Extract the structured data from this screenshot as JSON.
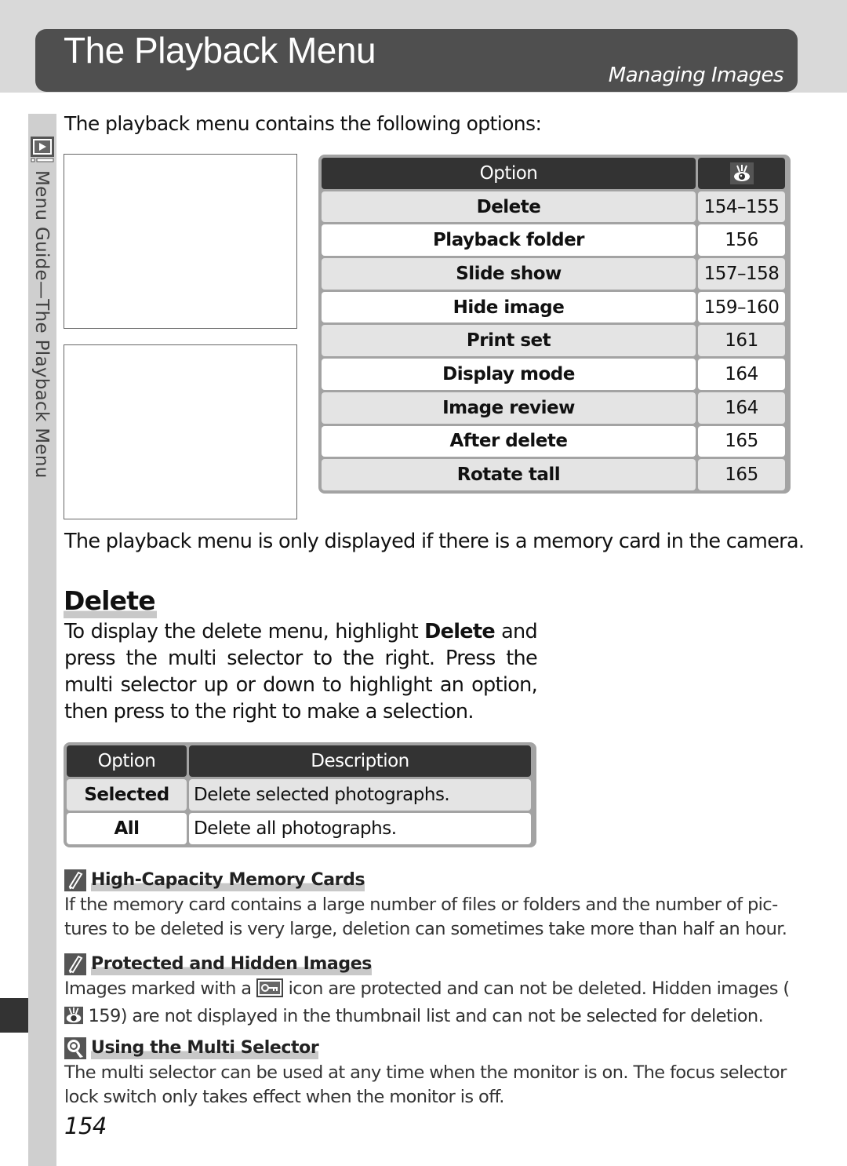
{
  "header": {
    "title": "The Playback Menu",
    "subtitle": "Managing Images",
    "bar_color": "#4f4f4f"
  },
  "side_tab": {
    "icon": "playback-icon",
    "label": "Menu Guide—The Playback Menu"
  },
  "intro": "The playback menu contains the following options:",
  "menu_table": {
    "headers": {
      "option": "Option",
      "page_icon": "eye-icon"
    },
    "rows": [
      {
        "option": "Delete",
        "pages": "154–155"
      },
      {
        "option": "Playback folder",
        "pages": "156"
      },
      {
        "option": "Slide show",
        "pages": "157–158"
      },
      {
        "option": "Hide image",
        "pages": "159–160"
      },
      {
        "option": "Print set",
        "pages": "161"
      },
      {
        "option": "Display mode",
        "pages": "164"
      },
      {
        "option": "Image review",
        "pages": "164"
      },
      {
        "option": "After delete",
        "pages": "165"
      },
      {
        "option": "Rotate tall",
        "pages": "165"
      }
    ]
  },
  "memory_note": "The playback menu is only displayed if there is a memory card in the camera.",
  "delete_section": {
    "heading": "Delete",
    "body_pre": "To display the delete menu, highlight ",
    "body_bold": "Delete",
    "body_post": " and press the multi selector to the right.  Press the multi selector up or down to highlight an option, then press to the right to make a selection.",
    "table": {
      "headers": {
        "option": "Option",
        "description": "Description"
      },
      "rows": [
        {
          "option": "Selected",
          "description": "Delete selected photographs."
        },
        {
          "option": "All",
          "description": "Delete all photographs."
        }
      ]
    }
  },
  "notes": [
    {
      "icon": "pencil-icon",
      "title": "High-Capacity Memory Cards",
      "text": "If the memory card contains a large number of files or folders and the number of pic-tures to be deleted is very large, deletion can sometimes take more than half an hour."
    },
    {
      "icon": "pencil-icon",
      "title": "Protected and Hidden Images",
      "text_1": "Images marked with a ",
      "inline_icon_1": "protect-key-icon",
      "text_2": " icon are protected and can not be deleted.  Hidden images (",
      "inline_icon_2": "eye-icon",
      "text_3": " 159) are not displayed in the thumbnail list and can not be selected for deletion."
    },
    {
      "icon": "tip-magnifier-icon",
      "title": "Using the Multi Selector",
      "text": "The multi selector can be used at any time when the monitor is on.  The focus selector lock switch only takes effect when the monitor is off."
    }
  ],
  "page_number": "154"
}
